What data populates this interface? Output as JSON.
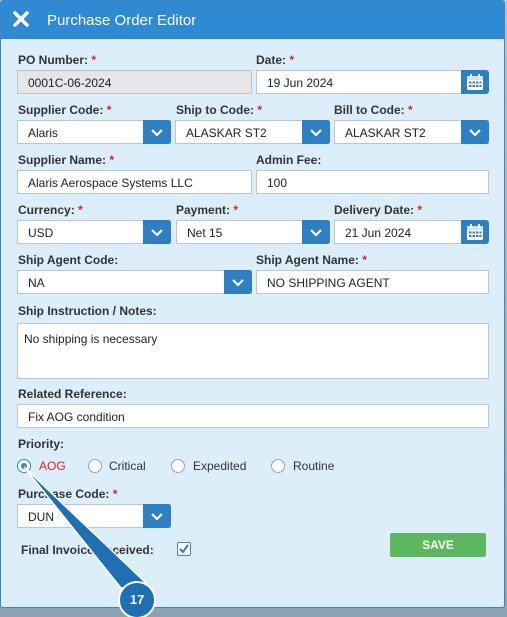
{
  "dialog": {
    "title": "Purchase Order Editor"
  },
  "form": {
    "po_number": {
      "label": "PO Number:",
      "value": "0001C-06-2024"
    },
    "date": {
      "label": "Date:",
      "value": "19 Jun 2024"
    },
    "supplier_code": {
      "label": "Supplier Code:",
      "value": "Alaris"
    },
    "ship_to_code": {
      "label": "Ship to Code:",
      "value": "ALASKAR ST2"
    },
    "bill_to_code": {
      "label": "Bill to Code:",
      "value": "ALASKAR ST2"
    },
    "supplier_name": {
      "label": "Supplier Name:",
      "value": "Alaris Aerospace Systems LLC"
    },
    "admin_fee": {
      "label": "Admin Fee:",
      "value": "100"
    },
    "currency": {
      "label": "Currency:",
      "value": "USD"
    },
    "payment": {
      "label": "Payment:",
      "value": "Net 15"
    },
    "delivery_date": {
      "label": "Delivery Date:",
      "value": "21 Jun 2024"
    },
    "ship_agent_code": {
      "label": "Ship Agent Code:",
      "value": "NA"
    },
    "ship_agent_name": {
      "label": "Ship Agent Name:",
      "value": "NO SHIPPING AGENT"
    },
    "ship_instruction": {
      "label": "Ship Instruction / Notes:",
      "value": "No shipping is necessary"
    },
    "related_reference": {
      "label": "Related Reference:",
      "value": "Fix AOG condition"
    },
    "priority": {
      "label": "Priority:",
      "options": [
        "AOG",
        "Critical",
        "Expedited",
        "Routine"
      ],
      "selected": "AOG"
    },
    "purchase_code": {
      "label": "Purchase Code:",
      "value": "DUN"
    },
    "final_invoice": {
      "label": "Final Invoice Received:",
      "checked": true
    },
    "required_mark": "*"
  },
  "actions": {
    "save_label": "SAVE"
  },
  "callout": {
    "number": "17"
  },
  "colors": {
    "header": "#2e8bd3",
    "accent": "#2f7fc4",
    "required": "#e02020",
    "save": "#5cb85c"
  }
}
